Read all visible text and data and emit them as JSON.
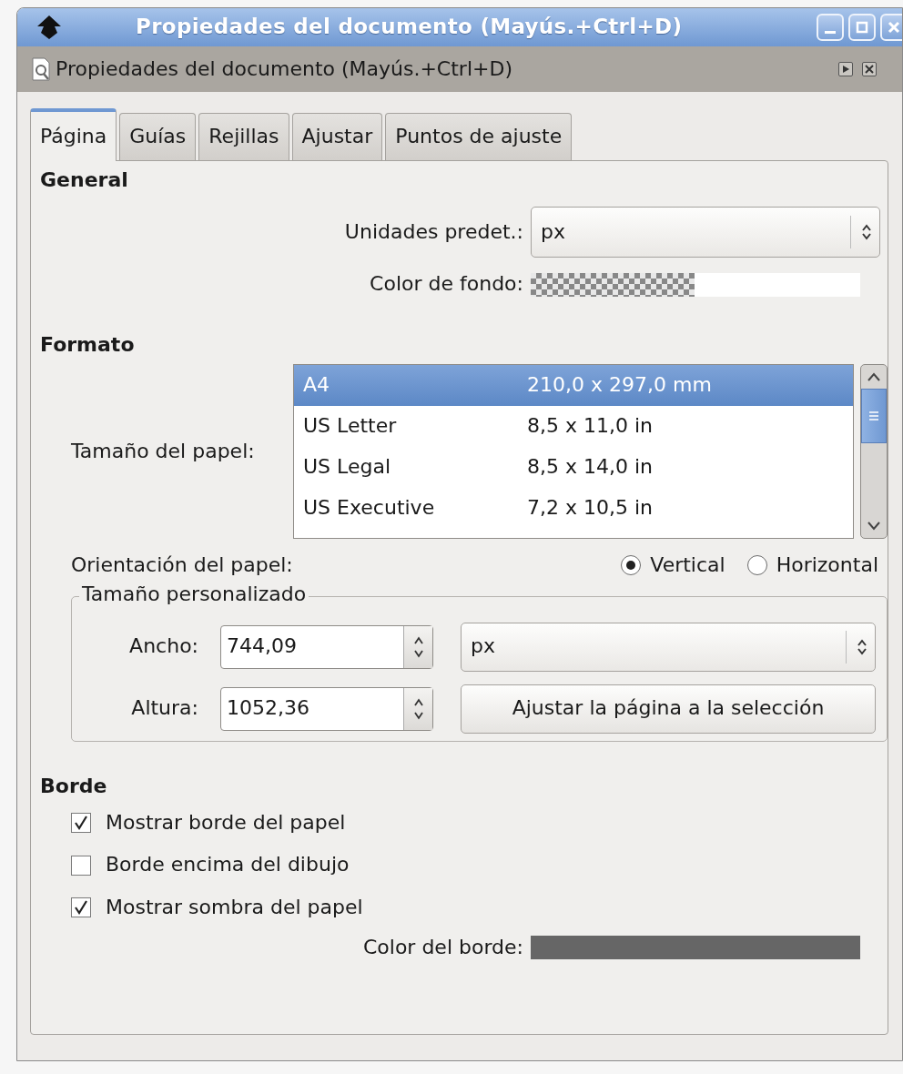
{
  "window": {
    "title": "Propiedades del documento (Mayús.+Ctrl+D)"
  },
  "dock": {
    "title": "Propiedades del documento (Mayús.+Ctrl+D)"
  },
  "tabs": [
    {
      "label": "Página",
      "selected": true
    },
    {
      "label": "Guías",
      "selected": false
    },
    {
      "label": "Rejillas",
      "selected": false
    },
    {
      "label": "Ajustar",
      "selected": false
    },
    {
      "label": "Puntos de ajuste",
      "selected": false
    }
  ],
  "general": {
    "heading": "General",
    "units": {
      "label": "Unidades predet.:",
      "value": "px"
    },
    "background": {
      "label": "Color de fondo:"
    }
  },
  "format": {
    "heading": "Formato",
    "paper_size": {
      "label": "Tamaño del papel:",
      "rows": [
        {
          "name": "A4",
          "size": "210,0 x 297,0 mm",
          "selected": true
        },
        {
          "name": "US Letter",
          "size": "8,5 x 11,0 in",
          "selected": false
        },
        {
          "name": "US Legal",
          "size": "8,5 x 14,0 in",
          "selected": false
        },
        {
          "name": "US Executive",
          "size": "7,2 x 10,5 in",
          "selected": false
        }
      ]
    },
    "orientation": {
      "label": "Orientación del papel:",
      "options": [
        {
          "label": "Vertical",
          "selected": true
        },
        {
          "label": "Horizontal",
          "selected": false
        }
      ]
    },
    "custom": {
      "legend": "Tamaño personalizado",
      "width": {
        "label": "Ancho:",
        "value": "744,09"
      },
      "height": {
        "label": "Altura:",
        "value": "1052,36"
      },
      "unit": "px",
      "fit_button": "Ajustar la página a la selección"
    }
  },
  "border": {
    "heading": "Borde",
    "options": [
      {
        "label": "Mostrar borde del papel",
        "checked": true
      },
      {
        "label": "Borde encima del dibujo",
        "checked": false
      },
      {
        "label": "Mostrar sombra del papel",
        "checked": true
      }
    ],
    "color": {
      "label": "Color del borde:",
      "color": "#666666"
    }
  }
}
